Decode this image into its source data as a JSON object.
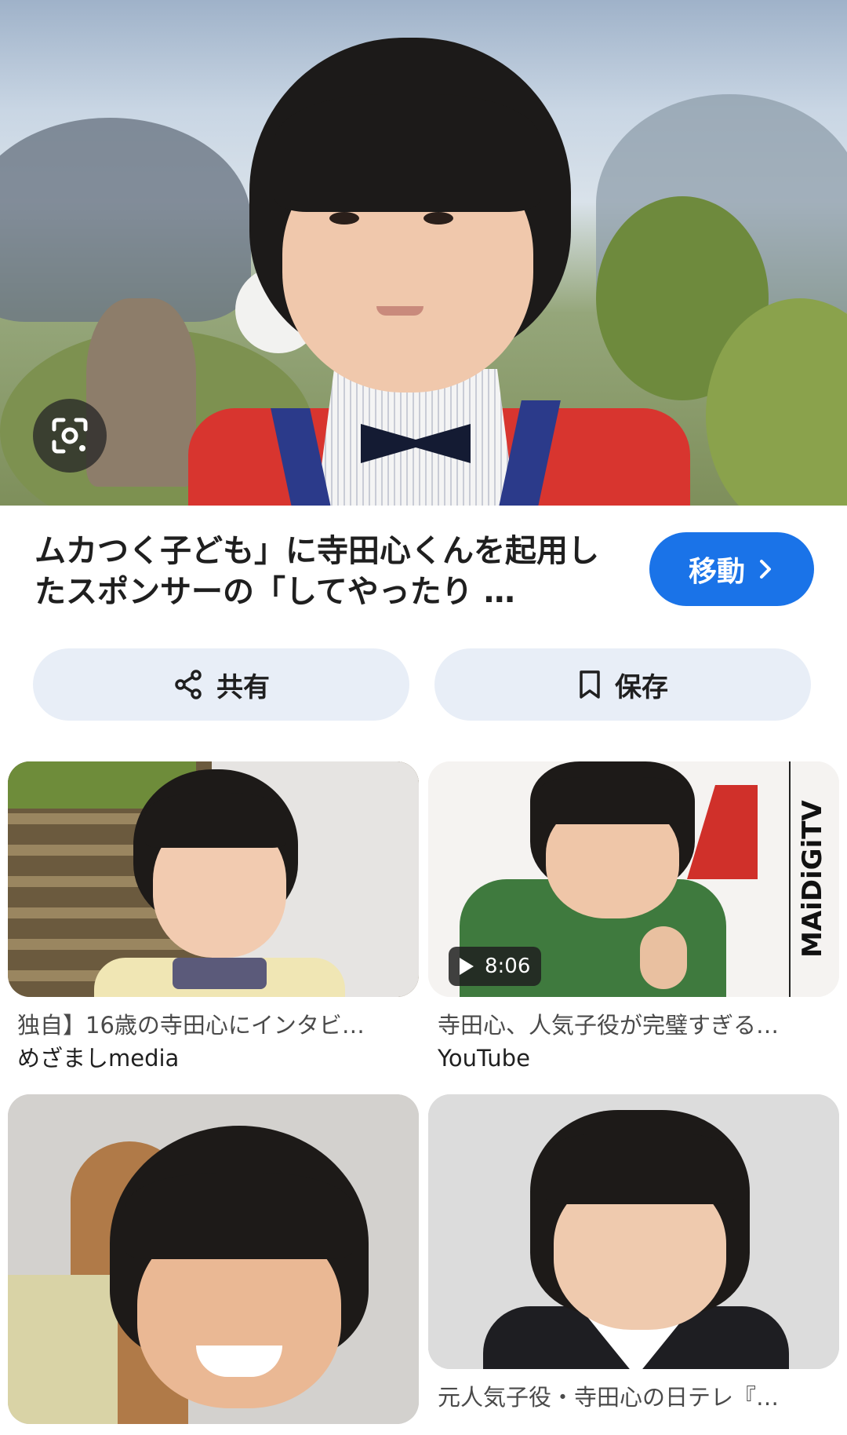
{
  "hero": {
    "lens_button_icon": "google-lens-icon"
  },
  "result": {
    "title": "ムカつく子ども」に寺田心くんを起用したスポンサーの「してやったり …",
    "visit_label": "移動",
    "visit_icon": "chevron-right-icon"
  },
  "actions": {
    "share_label": "共有",
    "share_icon": "share-icon",
    "save_label": "保存",
    "save_icon": "bookmark-icon"
  },
  "related": [
    {
      "caption": "独自】16歳の寺田心にインタビ…",
      "source": "めざましmedia"
    },
    {
      "caption": "寺田心、人気子役が完璧すぎる…",
      "source": "YouTube",
      "video_duration": "8:06",
      "watermark": "MAiDiGiTV"
    },
    {
      "caption": "",
      "source": ""
    },
    {
      "caption": "元人気子役・寺田心の日テレ『…",
      "source": ""
    }
  ],
  "colors": {
    "accent": "#1a73e8",
    "pill_bg": "#e8eef7"
  }
}
